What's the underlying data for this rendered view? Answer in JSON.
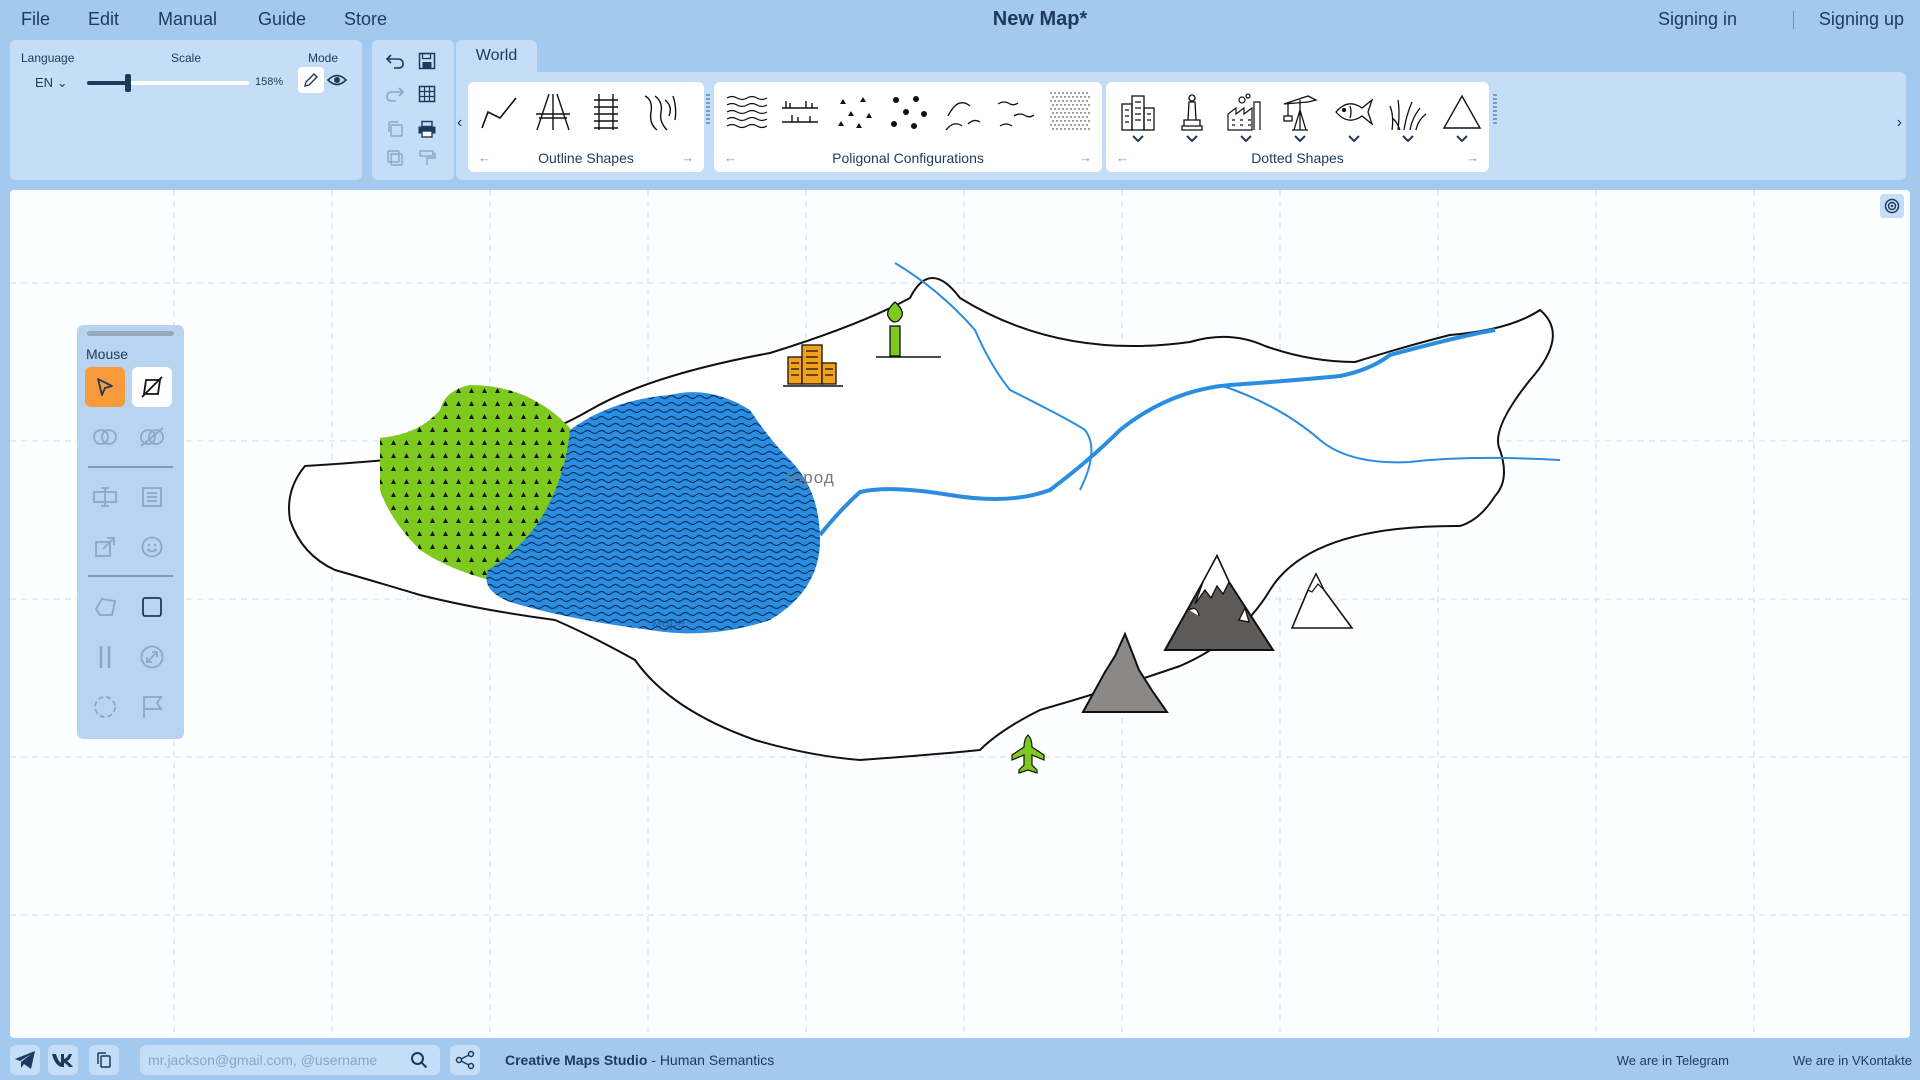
{
  "menu": {
    "file": "File",
    "edit": "Edit",
    "manual": "Manual",
    "guide": "Guide",
    "store": "Store"
  },
  "title": "New Map*",
  "auth": {
    "sign_in": "Signing in",
    "sign_up": "Signing up"
  },
  "settings": {
    "language_label": "Language",
    "language_value": "EN",
    "scale_label": "Scale",
    "scale_value": "158%",
    "scale_fraction": 0.25,
    "mode_label": "Mode"
  },
  "palette": {
    "tab": "World",
    "groups": [
      {
        "label": "Outline Shapes",
        "symbols": [
          "zigzag-line-icon",
          "road-icon",
          "railway-icon",
          "seaweed-icon"
        ]
      },
      {
        "label": "Poligonal Configurations",
        "symbols": [
          "water-waves-icon",
          "swamp-icon",
          "forest-dots-icon",
          "tree-clusters-icon",
          "hills-icon",
          "dunes-icon",
          "sand-dots-icon"
        ]
      },
      {
        "label": "Dotted Shapes",
        "symbols": [
          "city-icon",
          "monument-icon",
          "factory-icon",
          "oil-rig-icon",
          "fish-icon",
          "grass-icon",
          "mountain-icon"
        ]
      }
    ]
  },
  "tools": {
    "title": "Mouse"
  },
  "map": {
    "city_label": "город",
    "lake_label": "море",
    "colors": {
      "forest": "#7ec91e",
      "lake": "#2b8de0",
      "river": "#2b8de0",
      "outline": "#111111"
    }
  },
  "footer": {
    "search_placeholder": "mr.jackson@gmail.com, @username",
    "brand_name": "Creative Maps Studio",
    "brand_suffix": " - Human Semantics",
    "telegram": "We are in Telegram",
    "vkontakte": "We are in VKontakte"
  }
}
